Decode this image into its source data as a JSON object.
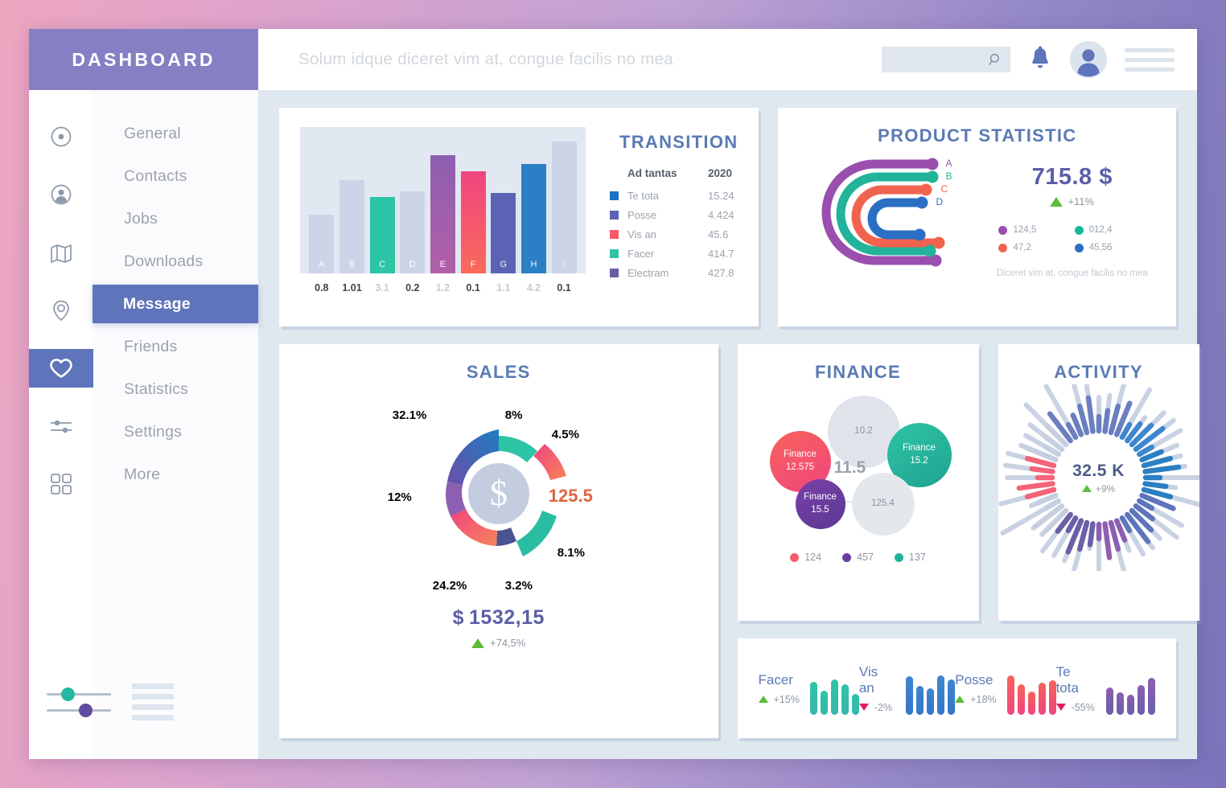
{
  "brand": {
    "title": "DASHBOARD"
  },
  "header": {
    "title": "Solum idque diceret vim at, congue facilis no mea",
    "search_placeholder": "",
    "search_value": ""
  },
  "sidebar": {
    "items": [
      {
        "label": "General",
        "icon": "target-icon",
        "active": false
      },
      {
        "label": "Contacts",
        "icon": "user-icon",
        "active": false
      },
      {
        "label": "Jobs",
        "icon": "map-icon",
        "active": false
      },
      {
        "label": "Downloads",
        "icon": "pin-icon",
        "active": false
      },
      {
        "label": "Message",
        "icon": "heart-icon",
        "active": true
      },
      {
        "label": "Friends",
        "icon": "sliders-icon",
        "active": false
      },
      {
        "label": "Statistics",
        "icon": "grid-icon",
        "active": false
      },
      {
        "label": "Settings",
        "icon": "",
        "active": false
      },
      {
        "label": "More",
        "icon": "",
        "active": false
      }
    ],
    "controls": {
      "slider_a_color": "#23b8a0",
      "slider_b_color": "#5e4a9e"
    }
  },
  "cards": {
    "transition": {
      "title": "TRANSITION"
    },
    "product": {
      "title": "PRODUCT STATISTIC"
    },
    "sales": {
      "title": "SALES"
    },
    "finance": {
      "title": "FINANCE"
    },
    "activity": {
      "title": "ACTIVITY"
    }
  },
  "chart_data": [
    {
      "type": "bar",
      "title": "TRANSITION",
      "categories": [
        "A",
        "B",
        "C",
        "D",
        "E",
        "F",
        "G",
        "H",
        "I"
      ],
      "values": [
        40,
        64,
        52,
        56,
        81,
        70,
        55,
        75,
        90
      ],
      "bar_labels": [
        "A",
        "B",
        "C",
        "D",
        "E",
        "F",
        "G",
        "H",
        "I"
      ],
      "tick_labels": [
        "0.8",
        "1.01",
        "3.1",
        "0.2",
        "1.2",
        "0.1",
        "1.1",
        "4.2",
        "0.1"
      ],
      "tick_muted": [
        false,
        false,
        true,
        false,
        true,
        false,
        true,
        true,
        false
      ],
      "colors": [
        "#ccd4e8",
        "#ccd4e8",
        "#2ec4a6",
        "#ccd4e8",
        "#8d5fb0",
        "#f0457f",
        "#5c63b5",
        "#2b7fc4",
        "#ccd4e8"
      ],
      "colors2": [
        "#ccd4e8",
        "#ccd4e8",
        "#2ec4a6",
        "#ccd4e8",
        "#b25fa8",
        "#fa6a5a",
        "#5c63b5",
        "#2b7fc4",
        "#ccd4e8"
      ],
      "grid": false,
      "legend": {
        "header": {
          "name": "Ad tantas",
          "value": "2020"
        },
        "rows": [
          {
            "name": "Te tota",
            "value": "15.24",
            "color": "#1b72c0"
          },
          {
            "name": "Posse",
            "value": "4.424",
            "color": "#5c63b5"
          },
          {
            "name": "Vis an",
            "value": "45.6",
            "color": "#f7596b"
          },
          {
            "name": "Facer",
            "value": "414.7",
            "color": "#2ec4a6"
          },
          {
            "name": "Electram",
            "value": "427.8",
            "color": "#6b5fa8"
          }
        ]
      }
    },
    {
      "type": "bar",
      "title": "PRODUCT STATISTIC",
      "orientation": "radial-u-bars",
      "categories": [
        "A",
        "B",
        "C",
        "D"
      ],
      "colors": [
        "#9a4fae",
        "#2ec4a6",
        "#f7635a",
        "#2b7fc4"
      ],
      "big_value": "715.8 $",
      "delta": "+11%",
      "delta_dir": "up",
      "legend": [
        {
          "label": "124,5",
          "color": "#9a4fae"
        },
        {
          "label": "012,4",
          "color": "#19b89a"
        },
        {
          "label": "47,2",
          "color": "#f1634f"
        },
        {
          "label": "45,56",
          "color": "#2b6fc4"
        }
      ],
      "note": "Diceret vim at,\ncongue facilis no mea"
    },
    {
      "type": "pie",
      "title": "SALES",
      "labels": [
        "8%",
        "4.5%",
        "8.1%",
        "3.2%",
        "24.2%",
        "12%",
        "32.1%"
      ],
      "values": [
        8,
        4.5,
        8.1,
        3.2,
        24.2,
        12,
        32.1
      ],
      "label_colors": [
        "#2ca58d",
        "#d5536f",
        "#2ca58d",
        "#44527a",
        "#ec6a4b",
        "#44527a",
        "#2a6fae"
      ],
      "center_icon": "dollar-icon",
      "side_value": "125.5",
      "total": "1532,15",
      "currency": "$",
      "delta": "+74,5%",
      "delta_dir": "up"
    },
    {
      "type": "scatter",
      "title": "FINANCE",
      "bubbles": [
        {
          "label": "",
          "value": "10.2",
          "color": "#dfe4ea",
          "text": "grey"
        },
        {
          "label": "Finance",
          "value": "12.575",
          "color": "#f35e6e",
          "text": "white"
        },
        {
          "label": "Finance",
          "value": "15.2",
          "color": "#23b29a",
          "text": "white"
        },
        {
          "label": "Finance",
          "value": "15.5",
          "color": "#6b3fa0",
          "text": "white"
        },
        {
          "label": "",
          "value": "125.4",
          "color": "#e3e8ed",
          "text": "grey"
        }
      ],
      "center_value": "11.5",
      "legend": [
        {
          "label": "124",
          "color": "#f35e6e"
        },
        {
          "label": "457",
          "color": "#6b3fa0"
        },
        {
          "label": "137",
          "color": "#23b29a"
        }
      ]
    },
    {
      "type": "bar",
      "title": "ACTIVITY",
      "orientation": "radial-spokes",
      "center_value": "32.5 K",
      "delta": "+9%",
      "delta_dir": "up"
    }
  ],
  "stats": [
    {
      "name": "Facer",
      "change": "+15%",
      "dir": "up",
      "color": "#2ec4a6",
      "color2": "#37b6ad",
      "bars": [
        62,
        45,
        66,
        58,
        40
      ]
    },
    {
      "name": "Vis an",
      "change": "-2%",
      "dir": "down",
      "color": "#3f86cf",
      "color2": "#3475c7",
      "bars": [
        72,
        55,
        50,
        74,
        66
      ]
    },
    {
      "name": "Posse",
      "change": "+18%",
      "dir": "up",
      "color": "#f7635a",
      "color2": "#f0457f",
      "bars": [
        74,
        58,
        44,
        60,
        65
      ]
    },
    {
      "name": "Te tota",
      "change": "-55%",
      "dir": "down",
      "color": "#8d5fb0",
      "color2": "#6b5fa8",
      "bars": [
        52,
        43,
        38,
        56,
        70
      ]
    }
  ]
}
